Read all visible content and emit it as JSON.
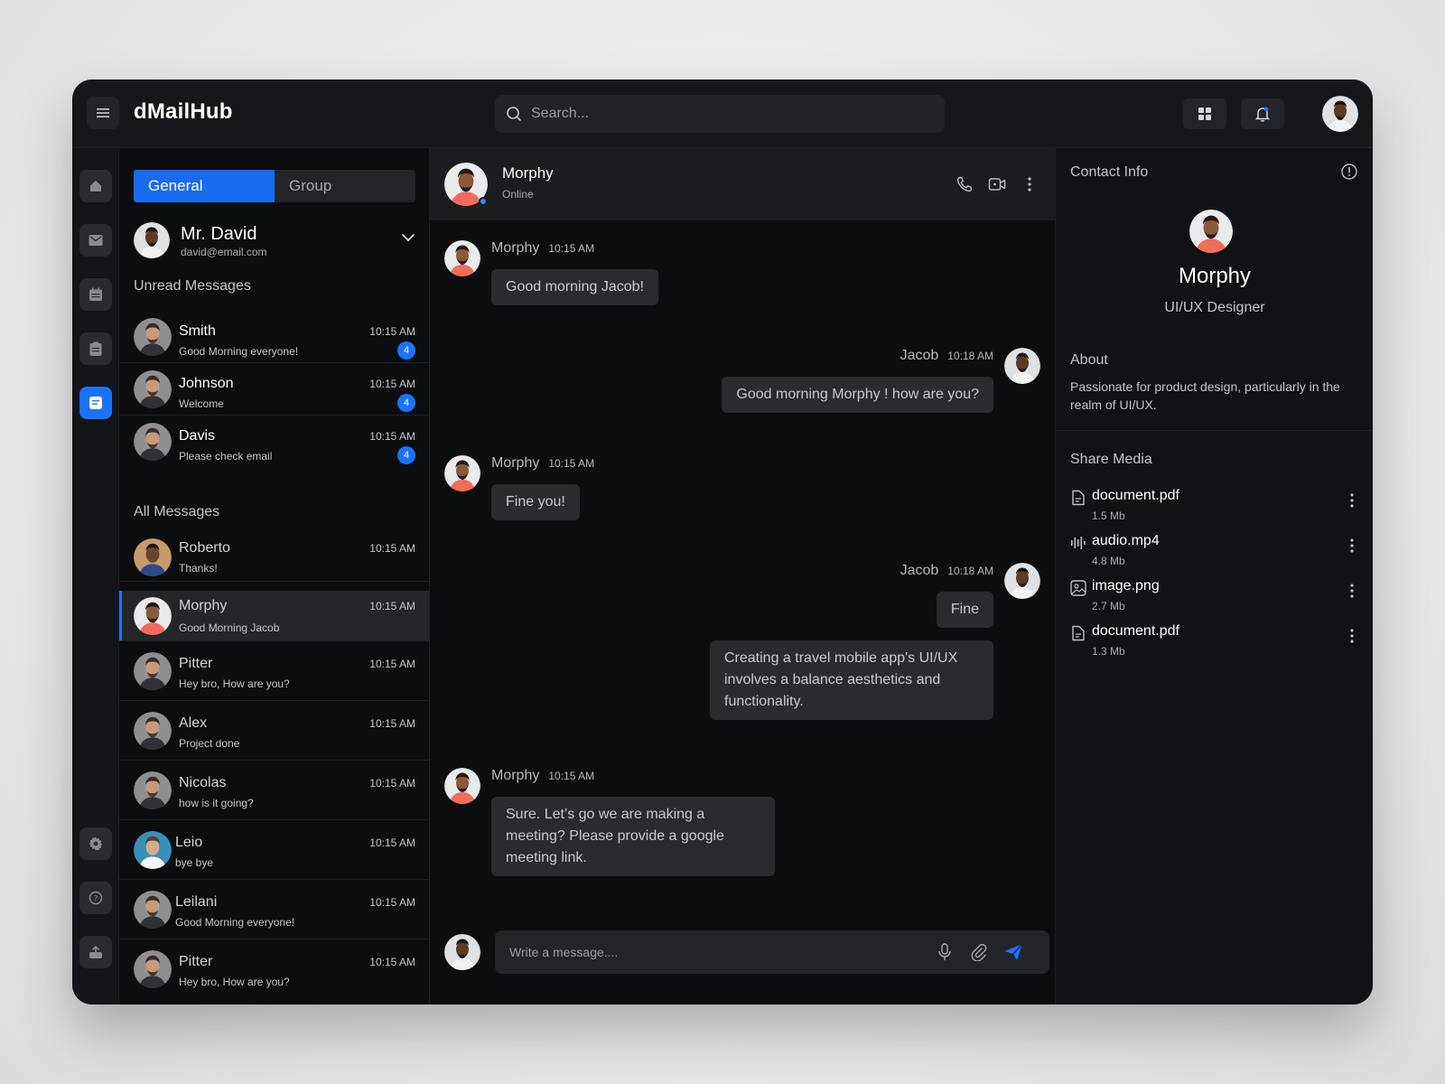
{
  "app": {
    "title": "dMailHub"
  },
  "search": {
    "placeholder": "Search..."
  },
  "tabs": [
    {
      "label": "General"
    },
    {
      "label": "Group"
    }
  ],
  "me": {
    "name": "Mr. David",
    "email": "david@email.com"
  },
  "unread": {
    "title": "Unread Messages",
    "items": [
      {
        "name": "Smith",
        "preview": "Good Morning everyone!",
        "time": "10:15 AM",
        "badge": "4"
      },
      {
        "name": "Johnson",
        "preview": "Welcome",
        "time": "10:15 AM",
        "badge": "4"
      },
      {
        "name": "Davis",
        "preview": "Please check email",
        "time": "10:15 AM",
        "badge": "4"
      }
    ]
  },
  "all": {
    "title": "All Messages",
    "items": [
      {
        "name": "Roberto",
        "preview": "Thanks!",
        "time": "10:15 AM"
      },
      {
        "name": "Morphy",
        "preview": "Good Morning Jacob",
        "time": "10:15 AM"
      },
      {
        "name": "Pitter",
        "preview": "Hey bro, How are you?",
        "time": "10:15 AM"
      },
      {
        "name": "Alex",
        "preview": "Project done",
        "time": "10:15 AM"
      },
      {
        "name": "Nicolas",
        "preview": "how is it going?",
        "time": "10:15 AM"
      },
      {
        "name": "Leio",
        "preview": "bye bye",
        "time": "10:15 AM"
      },
      {
        "name": "Leilani",
        "preview": "Good Morning everyone!",
        "time": "10:15 AM"
      },
      {
        "name": "Pitter",
        "preview": "Hey bro, How are you?",
        "time": "10:15 AM"
      }
    ]
  },
  "chat": {
    "contact": "Morphy",
    "status": "Online",
    "messages": [
      {
        "sender": "Morphy",
        "time": "10:15 AM",
        "texts": [
          "Good morning Jacob!"
        ]
      },
      {
        "sender": "Jacob",
        "time": "10:18 AM",
        "texts": [
          "Good morning Morphy ! how are you?"
        ]
      },
      {
        "sender": "Morphy",
        "time": "10:15 AM",
        "texts": [
          "Fine you!"
        ]
      },
      {
        "sender": "Jacob",
        "time": "10:18 AM",
        "texts": [
          "Fine",
          "Creating a travel mobile app's UI/UX involves a balance aesthetics and functionality."
        ]
      },
      {
        "sender": "Morphy",
        "time": "10:15 AM",
        "texts": [
          "Sure. Let’s go we are making a meeting? Please provide a  google meeting link."
        ]
      }
    ],
    "composer_placeholder": "Write a message...."
  },
  "contact_info": {
    "title": "Contact Info",
    "name": "Morphy",
    "role": "UI/UX Designer",
    "about_title": "About",
    "about": "Passionate for product design, particularly in the realm of UI/UX.",
    "share_title": "Share Media",
    "files": [
      {
        "name": "document.pdf",
        "size": "1.5 Mb",
        "icon": "file-icon"
      },
      {
        "name": "audio.mp4",
        "size": "4.8 Mb",
        "icon": "audio-wave-icon"
      },
      {
        "name": "image.png",
        "size": "2.7 Mb",
        "icon": "image-icon"
      },
      {
        "name": "document.pdf",
        "size": "1.3 Mb",
        "icon": "file-icon"
      }
    ]
  },
  "colors": {
    "accent": "#1a73ff",
    "background": "#0c0d0f",
    "panel": "#16171a",
    "bubble": "#2a2b2f"
  }
}
